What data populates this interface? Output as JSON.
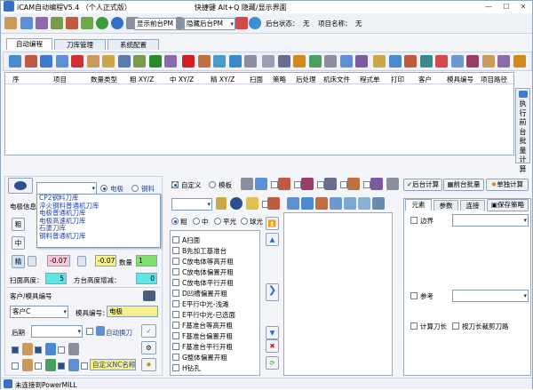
{
  "window": {
    "title": "iCAM自动编程V5.4 （个人正式版）",
    "hotkey_hint": "快捷键 Alt+Q 隐藏/显示界面"
  },
  "toolbar": {
    "front_pm": "显示前台PM",
    "back_pm": "隐藏后台PM",
    "bg_status_label": "后台状态：",
    "bg_status_value": "无",
    "project_label": "项目名称：",
    "project_value": "无"
  },
  "tabs": [
    "自动编程",
    "刀库管理",
    "系统配置"
  ],
  "table": {
    "columns": [
      "序",
      "项目",
      "数量类型",
      "粗 XY/Z",
      "中 XY/Z",
      "精 XY/Z",
      "扫面",
      "策略",
      "后处理",
      "机床文件",
      "程式单",
      "打印",
      "客户",
      "模具编号",
      "项目路径"
    ]
  },
  "side_button": {
    "chars": [
      "执",
      "行",
      "前",
      "台",
      "批",
      "量",
      "计",
      "算"
    ]
  },
  "left": {
    "mode_electrode": "电极",
    "mode_steel": "钢料",
    "electrode_label": "电极信息",
    "rough_btn": "粗",
    "mid_btn": "中",
    "fine_btn": "精",
    "dd_items": [
      "CP2钢料刀库",
      "淬火钢料普通机刀库",
      "电极普通机刀库",
      "电极高速机刀库",
      "石墨刀库",
      "钢料普通机刀库"
    ],
    "val1": "-0.07",
    "val2": "-0.07",
    "qty_label": "数量",
    "qty_value": "1",
    "scan_label": "扫面高度：",
    "scan_value": "5",
    "platform_label": "方台高度增减：",
    "platform_value": "0",
    "customer_label": "客户/模具编号",
    "customer_value": "客户C",
    "mold_label": "模具编号：",
    "mold_value": "电极",
    "post_label": "后期",
    "auto_tool_label": "自动换刀",
    "custom_nc_label": "自定义NC名称"
  },
  "mid": {
    "custom_label": "自定义",
    "template_label": "模板",
    "radio_labels": [
      "粗",
      "中",
      "平光",
      "球光"
    ],
    "bg_calc": "后台计算",
    "front_batch": "前台批量",
    "single_calc": "单独计算",
    "list": [
      "A扫面",
      "B先加工基准台",
      "C放电体等高开粗",
      "C放电体偏置开粗",
      "C放电体平行开粗",
      "D凹槽偏置开粗",
      "E平行中光-浅滩",
      "E平行中光-已选面",
      "F基准台等高开粗",
      "F基准台偏置开粗",
      "F基准台平行开粗",
      "G整体偏置开粗",
      "H钻孔"
    ]
  },
  "right": {
    "tabs": [
      "元素",
      "参数",
      "连接"
    ],
    "save_strategy": "保存策略",
    "border": "边界",
    "ref": "参考",
    "calc_tool_len": "计算刀长",
    "clip_tool_len": "按刀长裁剪刀路"
  },
  "status": {
    "text": "未连接到PowerMILL"
  },
  "colors": {
    "accent": "#1d3fb0",
    "pink": "#f7c8d6",
    "yellow": "#f7f08a",
    "cyan": "#5ee6e6",
    "green": "#7ee06e"
  }
}
